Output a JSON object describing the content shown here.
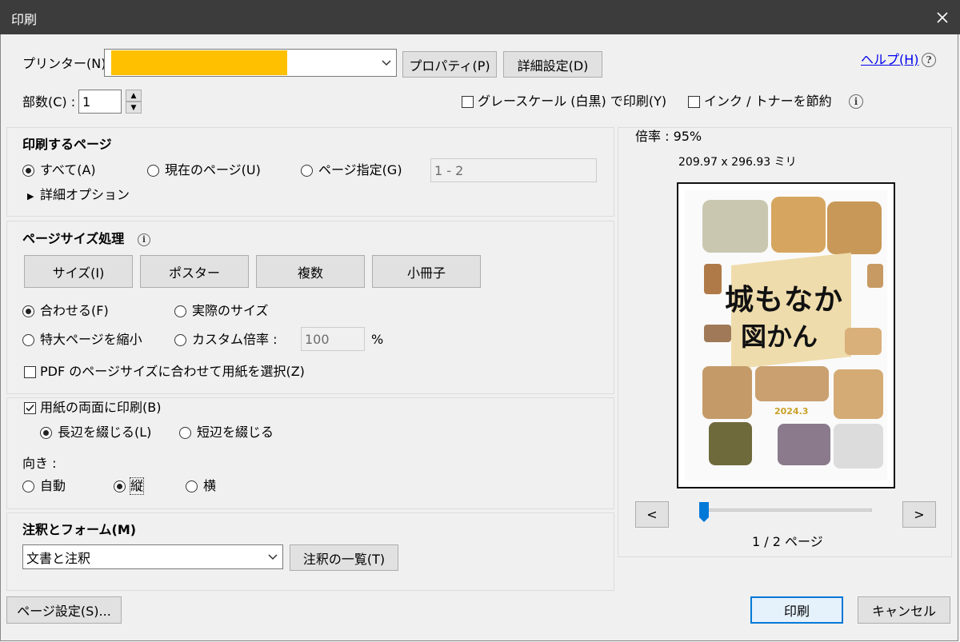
{
  "window": {
    "title": "印刷"
  },
  "printer": {
    "label": "プリンター(N) :",
    "name": "",
    "redaction_color": "#ffc000",
    "properties_label": "プロパティ(P)",
    "advanced_label": "詳細設定(D)",
    "help_label": "ヘルプ(H)"
  },
  "copies": {
    "label": "部数(C) :",
    "value": "1"
  },
  "options": {
    "grayscale_label": "グレースケール (白黒) で印刷(Y)",
    "save_ink_label": "インク / トナーを節約"
  },
  "pages_to_print": {
    "heading": "印刷するページ",
    "all_label": "すべて(A)",
    "current_label": "現在のページ(U)",
    "range_label": "ページ指定(G)",
    "range_value": "1 - 2",
    "more_options_label": "詳細オプション",
    "selected": "all"
  },
  "page_sizing": {
    "heading": "ページサイズ処理",
    "tabs": [
      "サイズ(I)",
      "ポスター",
      "複数",
      "小冊子"
    ],
    "fit_label": "合わせる(F)",
    "actual_label": "実際のサイズ",
    "shrink_label": "特大ページを縮小",
    "custom_label": "カスタム倍率 :",
    "custom_value": "100",
    "percent": "%",
    "pdf_paper_label": "PDF のページサイズに合わせて用紙を選択(Z)",
    "selected": "fit"
  },
  "duplex": {
    "both_sides_label": "用紙の両面に印刷(B)",
    "both_sides_checked": true,
    "long_edge_label": "長辺を綴じる(L)",
    "short_edge_label": "短辺を綴じる",
    "selected": "long"
  },
  "orientation": {
    "label": "向き :",
    "auto_label": "自動",
    "portrait_label": "縦",
    "landscape_label": "横",
    "selected": "portrait"
  },
  "comments": {
    "heading": "注釈とフォーム(M)",
    "value": "文書と注釈",
    "summary_label": "注釈の一覧(T)"
  },
  "preview": {
    "scale_label": "倍率 : 95%",
    "dimensions": "209.97 x 296.93 ミリ",
    "page_title_line1": "城もなか",
    "page_title_line2": "図かん",
    "page_date": "2024.3",
    "prev_label": "<",
    "next_label": ">",
    "page_indicator": "1 / 2 ページ",
    "slider_fraction": 0
  },
  "footer": {
    "page_setup_label": "ページ設定(S)...",
    "print_label": "印刷",
    "cancel_label": "キャンセル"
  }
}
